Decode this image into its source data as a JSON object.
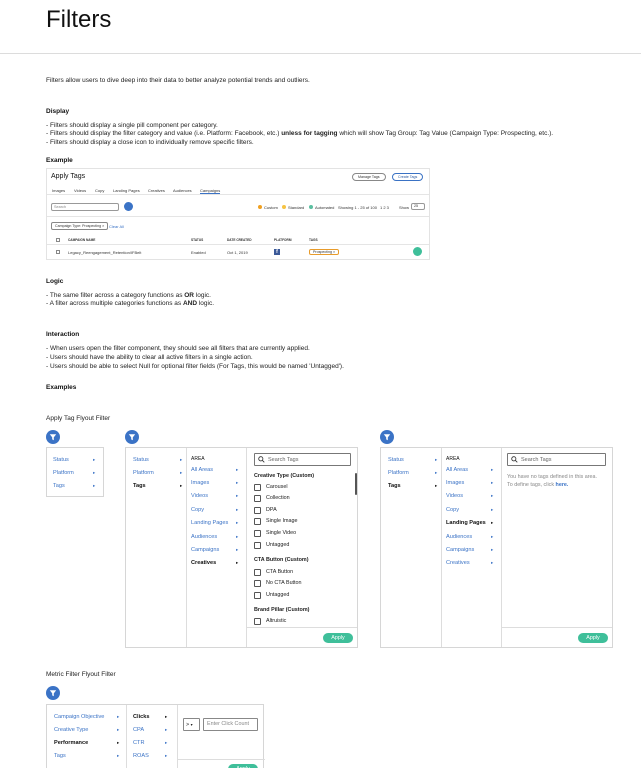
{
  "page": {
    "title": "Filters",
    "intro": "Filters allow users to dive deep into their data to better analyze potential trends and outliers."
  },
  "display": {
    "heading": "Display",
    "l1": "- Filters should display a single pill component per category.",
    "l2a": "- Filters should display the filter category and value (i.e. Platform: Facebook, etc.) ",
    "l2b": "unless for tagging",
    "l2c": " which will show Tag Group: Tag Value (Campaign Type: Prospecting, etc.).",
    "l3": "- Filters should display a close icon to individually remove specific filters."
  },
  "example": {
    "heading": "Example",
    "title": "Apply Tags",
    "manage_tags": "Manage Tags",
    "create_tags": "Create Tags",
    "tabs": [
      "Images",
      "Videos",
      "Copy",
      "Landing Pages",
      "Creatives",
      "Audiences",
      "Campaigns"
    ],
    "search_placeholder": "Search",
    "legend": [
      "Custom",
      "Standard",
      "Automated"
    ],
    "showing": "Showing 1 - 25 of 100",
    "pager": "1 2 3",
    "show_label": "Show",
    "show_value": "25",
    "filter_pill": "Campaign Type: Prospecting",
    "clear_all": "Clear All",
    "columns": [
      "CAMPAIGN NAME",
      "STATUS",
      "DATE CREATED",
      "PLATFORM",
      "TAGS"
    ],
    "row": {
      "name": "Legacy_Reengagement_Retention/IFBelt",
      "status": "Enabled",
      "date": "Oct 1, 2019",
      "tag": "Prospecting"
    }
  },
  "logic": {
    "heading": "Logic",
    "l1a": "- The same filter across a category functions as ",
    "l1b": "OR",
    "l1c": " logic.",
    "l2a": "- A filter across multiple categories functions as ",
    "l2b": "AND",
    "l2c": " logic."
  },
  "interaction": {
    "heading": "Interaction",
    "l1": "- When users open the filter component, they should see all filters that are currently applied.",
    "l2": "- Users should have the ability to clear all active filters in a single action.",
    "l3": "- Users should be able to select Null for optional filter fields (For Tags, this would be named 'Untagged')."
  },
  "examples": {
    "heading": "Examples",
    "tag_flyout_title": "Apply Tag Flyout Filter",
    "level1": [
      "Status",
      "Platform",
      "Tags"
    ],
    "area_label": "AREA",
    "areas_a": [
      "All Areas",
      "Images",
      "Videos",
      "Copy",
      "Landing Pages",
      "Audiences",
      "Campaigns",
      "Creatives"
    ],
    "areas_b": [
      "All Areas",
      "Images",
      "Videos",
      "Copy",
      "Landing Pages",
      "Audiences",
      "Campaigns",
      "Creatives"
    ],
    "search_tags": "Search Tags",
    "groups": {
      "creative_type": "Creative Type (Custom)",
      "cta_button": "CTA Button (Custom)",
      "brand_pillar": "Brand Pillar (Custom)"
    },
    "creative_type_items": [
      "Carousel",
      "Collection",
      "DPA",
      "Single Image",
      "Single Video",
      "Untagged"
    ],
    "cta_items": [
      "CTA Button",
      "No CTA Button",
      "Untagged"
    ],
    "brand_items": [
      "Altruistic"
    ],
    "no_tags_1": "You have no tags defined in this area.",
    "no_tags_2a": "To define tags, click ",
    "no_tags_2b": "here.",
    "apply": "Apply",
    "metric_title": "Metric Filter Flyout Filter",
    "metric_l1": [
      "Campaign Objective",
      "Creative Type",
      "Performance",
      "Tags"
    ],
    "metric_l2": [
      "Clicks",
      "CPA",
      "CTR",
      "ROAS"
    ],
    "operator": ">",
    "click_count_placeholder": "Enter Click Count"
  },
  "colors": {
    "accent": "#3b73c6",
    "apply_green": "#3fbf9a"
  }
}
